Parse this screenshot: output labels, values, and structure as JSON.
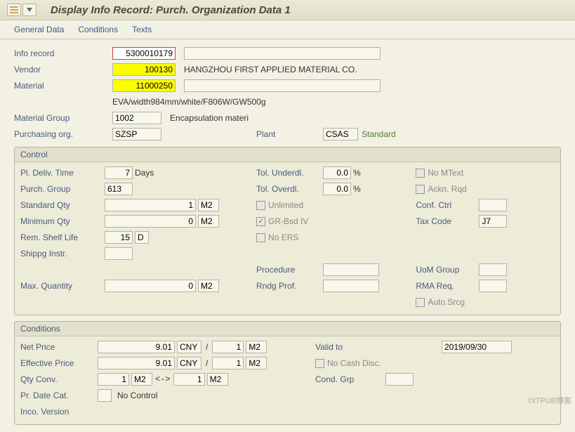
{
  "title": "Display Info Record: Purch. Organization Data 1",
  "menu": {
    "general": "General Data",
    "conditions": "Conditions",
    "texts": "Texts"
  },
  "header": {
    "info_record_label": "Info record",
    "info_record": "5300010179",
    "vendor_label": "Vendor",
    "vendor": "100130",
    "vendor_desc": "HANGZHOU FIRST APPLIED MATERIAL CO.",
    "material_label": "Material",
    "material": "11000250",
    "material_desc": "EVA/width984mm/white/F806W/GW500g",
    "matgroup_label": "Material Group",
    "matgroup": "1002",
    "matgroup_desc": "Encapsulation materi",
    "porg_label": "Purchasing org.",
    "porg": "SZSP",
    "plant_label": "Plant",
    "plant": "CSAS",
    "plant_desc": "Standard"
  },
  "control": {
    "title": "Control",
    "deliv_label": "Pl. Deliv. Time",
    "deliv": "7",
    "days": "Days",
    "pgroup_label": "Purch. Group",
    "pgroup": "613",
    "stdqty_label": "Standard Qty",
    "stdqty": "1",
    "uom": "M2",
    "minqty_label": "Minimum Qty",
    "minqty": "0",
    "shelf_label": "Rem. Shelf Life",
    "shelf": "15",
    "shelf_unit": "D",
    "shippg_label": "Shippg Instr.",
    "maxqty_label": "Max. Quantity",
    "maxqty": "0",
    "tol_under_label": "Tol. Underdl.",
    "tol_under": "0.0",
    "pct": "%",
    "tol_over_label": "Tol. Overdl.",
    "tol_over": "0.0",
    "unlimited": "Unlimited",
    "grbsd": "GR-Bsd IV",
    "noers": "No ERS",
    "procedure_label": "Procedure",
    "rndg_label": "Rndg Prof.",
    "nomtext": "No MText",
    "acknrqd": "Ackn. Rqd",
    "confctrl_label": "Conf. Ctrl",
    "taxcode_label": "Tax Code",
    "taxcode": "J7",
    "uomgroup_label": "UoM Group",
    "rmareq_label": "RMA Req.",
    "autosrcg": "Auto.Srcg"
  },
  "conditions": {
    "title": "Conditions",
    "net_label": "Net Price",
    "net": "9.01",
    "curr": "CNY",
    "per": "1",
    "uom": "M2",
    "eff_label": "Effective Price",
    "eff": "9.01",
    "qtyconv_label": "Qty Conv.",
    "qtyconv1": "1",
    "qtyconv2": "1",
    "prdate_label": "Pr. Date Cat.",
    "prdate_desc": "No Control",
    "incov_label": "Inco. Version",
    "valid_label": "Valid to",
    "valid": "2019/09/30",
    "nocash": "No Cash Disc.",
    "condgrp_label": "Cond. Grp"
  },
  "watermark": "©ITPUB博客"
}
